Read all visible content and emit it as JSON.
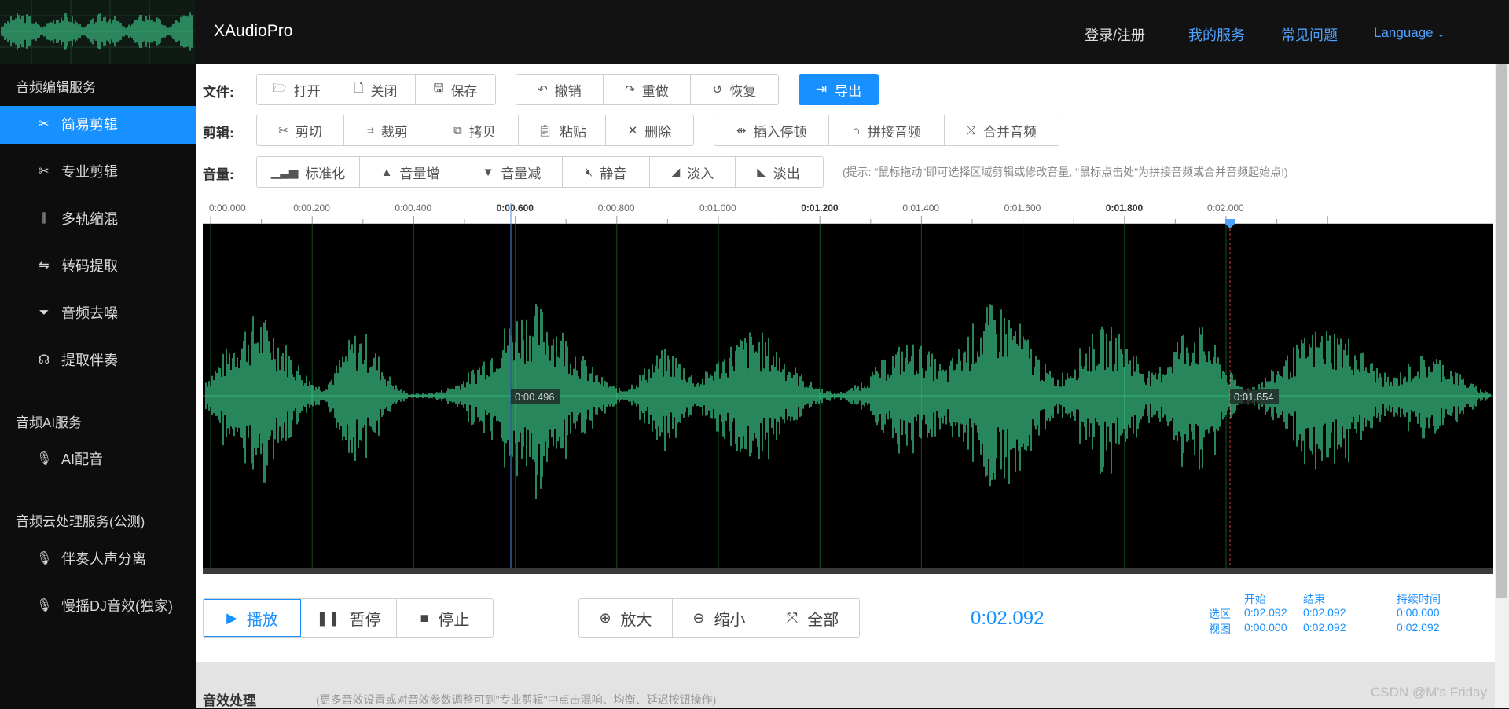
{
  "header": {
    "app_title": "XAudioPro",
    "nav": {
      "login": "登录/注册",
      "my_services": "我的服务",
      "faq": "常见问题",
      "language": "Language"
    }
  },
  "sidebar": {
    "groups": [
      {
        "title": "音频编辑服务"
      },
      {
        "title": "音频AI服务"
      },
      {
        "title": "音频云处理服务(公测)"
      }
    ],
    "items": [
      {
        "label": "简易剪辑",
        "icon": "scissors-icon",
        "active": true
      },
      {
        "label": "专业剪辑",
        "icon": "scissors-icon"
      },
      {
        "label": "多轨缩混",
        "icon": "sliders-icon"
      },
      {
        "label": "转码提取",
        "icon": "swap-icon"
      },
      {
        "label": "音频去噪",
        "icon": "filter-icon"
      },
      {
        "label": "提取伴奏",
        "icon": "headphones-icon"
      },
      {
        "label": "AI配音",
        "icon": "microphone-icon"
      },
      {
        "label": "伴奏人声分离",
        "icon": "microphone-icon"
      },
      {
        "label": "慢摇DJ音效(独家)",
        "icon": "microphone-icon"
      }
    ]
  },
  "toolbar": {
    "file_label": "文件:",
    "edit_label": "剪辑:",
    "volume_label": "音量:",
    "file": {
      "open": "打开",
      "close": "关闭",
      "save": "保存",
      "undo": "撤销",
      "redo": "重做",
      "restore": "恢复",
      "export": "导出"
    },
    "edit": {
      "cut": "剪切",
      "crop": "裁剪",
      "copy": "拷贝",
      "paste": "粘贴",
      "delete": "删除",
      "insert_pause": "插入停顿",
      "splice": "拼接音频",
      "merge": "合并音频"
    },
    "volume": {
      "normalize": "标准化",
      "vol_up": "音量增",
      "vol_down": "音量减",
      "mute": "静音",
      "fade_in": "淡入",
      "fade_out": "淡出"
    },
    "hint": "(提示: \"鼠标拖动\"即可选择区域剪辑或修改音量, \"鼠标点击处\"为拼接音频或合并音频起始点!)"
  },
  "waveform": {
    "timeline": [
      "0:00.000",
      "0:00.200",
      "0:00.400",
      "0:00.600",
      "0:00.800",
      "0:01.000",
      "0:01.200",
      "0:01.400",
      "0:01.600",
      "0:01.800",
      "0:02.000"
    ],
    "cursor_time": "0:00.496",
    "playhead_time": "0:01.654",
    "wave_color": "#3ecf8e",
    "background": "#000000"
  },
  "controls": {
    "play": "播放",
    "pause": "暂停",
    "stop": "停止",
    "zoom_in": "放大",
    "zoom_out": "缩小",
    "all": "全部",
    "current_time": "0:02.092"
  },
  "selection_info": {
    "col_start": "开始",
    "col_end": "结束",
    "col_duration": "持续时间",
    "row_selection": "选区",
    "row_view": "视图",
    "selection": {
      "start": "0:02.092",
      "end": "0:02.092",
      "duration": "0:00.000"
    },
    "view": {
      "start": "0:00.000",
      "end": "0:02.092",
      "duration": "0:02.092"
    }
  },
  "effects": {
    "title": "音效处理",
    "note": "(更多音效设置或对音效参数调整可到\"专业剪辑\"中点击混响、均衡、延迟按钮操作)"
  },
  "watermark": "CSDN @M's Friday"
}
